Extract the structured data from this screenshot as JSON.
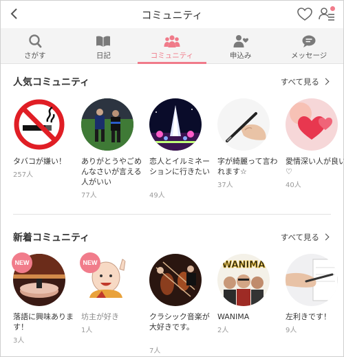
{
  "header": {
    "title": "コミュニティ",
    "notification_color": "#f17c8b"
  },
  "tabs": [
    {
      "label": "さがす",
      "icon": "search-icon",
      "active": false
    },
    {
      "label": "日記",
      "icon": "book-icon",
      "active": false
    },
    {
      "label": "コミュニティ",
      "icon": "people-icon",
      "active": true
    },
    {
      "label": "申込み",
      "icon": "person-heart-icon",
      "active": false
    },
    {
      "label": "メッセージ",
      "icon": "chat-bubble-icon",
      "active": false
    }
  ],
  "accent_color": "#f07a89",
  "popular": {
    "title": "人気コミュニティ",
    "see_all": "すべて見る",
    "items": [
      {
        "name": "タバコが嫌い！",
        "count": "257人",
        "image": "no-smoking-sign"
      },
      {
        "name": "ありがとうやごめんなさいが言える人がいい",
        "count": "77人",
        "image": "soccer-players"
      },
      {
        "name": "恋人とイルミネーションに行きたい",
        "count": "49人",
        "image": "illumination"
      },
      {
        "name": "字が綺麗って言われます☆",
        "count": "37人",
        "image": "writing-pen"
      },
      {
        "name": "愛情深い人が良い♡",
        "count": "40人",
        "image": "heart-balloons"
      }
    ]
  },
  "new": {
    "title": "新着コミュニティ",
    "see_all": "すべて見る",
    "badge": "NEW",
    "items": [
      {
        "name": "落語に興味あります！",
        "count": "3人",
        "image": "rakugo-stage",
        "is_new": true
      },
      {
        "name": "坊主が好き",
        "count": "1人",
        "image": "monk-illustration",
        "is_new": true
      },
      {
        "name": "クラシック音楽が大好きです。",
        "count": "7人",
        "image": "orchestra",
        "is_new": false
      },
      {
        "name": "WANIMA",
        "count": "2人",
        "image": "band-wanima",
        "is_new": false
      },
      {
        "name": "左利きです！",
        "count": "9人",
        "image": "left-hand-writing",
        "is_new": false
      }
    ]
  }
}
